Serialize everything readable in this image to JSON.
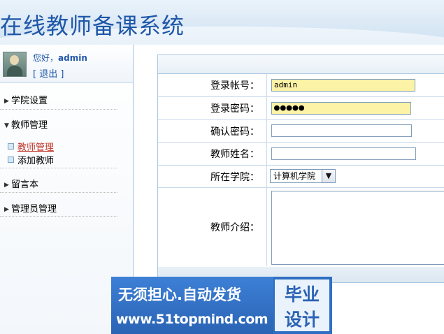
{
  "header": {
    "title": "在线教师备课系统"
  },
  "sidebar": {
    "greeting_prefix": "您好，",
    "username": "admin",
    "logout": "[ 退出 ]",
    "menu": [
      {
        "label": "学院设置",
        "expanded": false
      },
      {
        "label": "教师管理",
        "expanded": true,
        "children": [
          {
            "label": "教师管理",
            "active": true
          },
          {
            "label": "添加教师",
            "active": false
          }
        ]
      },
      {
        "label": "留言本",
        "expanded": false
      },
      {
        "label": "管理员管理",
        "expanded": false
      }
    ]
  },
  "form": {
    "fields": [
      {
        "label": "登录帐号：",
        "value": "admin",
        "highlighted": true
      },
      {
        "label": "登录密码：",
        "value": "●●●●●",
        "highlighted": true
      },
      {
        "label": "确认密码：",
        "value": ""
      },
      {
        "label": "教师姓名：",
        "value": ""
      },
      {
        "label": "所在学院：",
        "selected": "计算机学院"
      },
      {
        "label": "教师介绍：",
        "value": ""
      }
    ]
  },
  "watermark": {
    "slogan": "无须担心.自动发货",
    "url": "www.51topmind.com",
    "badge_line1": "毕业",
    "badge_line2": "设计"
  },
  "colors": {
    "title": "#1f57a8",
    "highlight_input": "#fdf3a6",
    "border": "#a9c4e0",
    "watermark_bg": "#2f6fc3"
  },
  "icons": [
    "avatar",
    "triangle-right-icon",
    "triangle-down-icon",
    "square-bullet-icon",
    "chevron-down-icon"
  ]
}
